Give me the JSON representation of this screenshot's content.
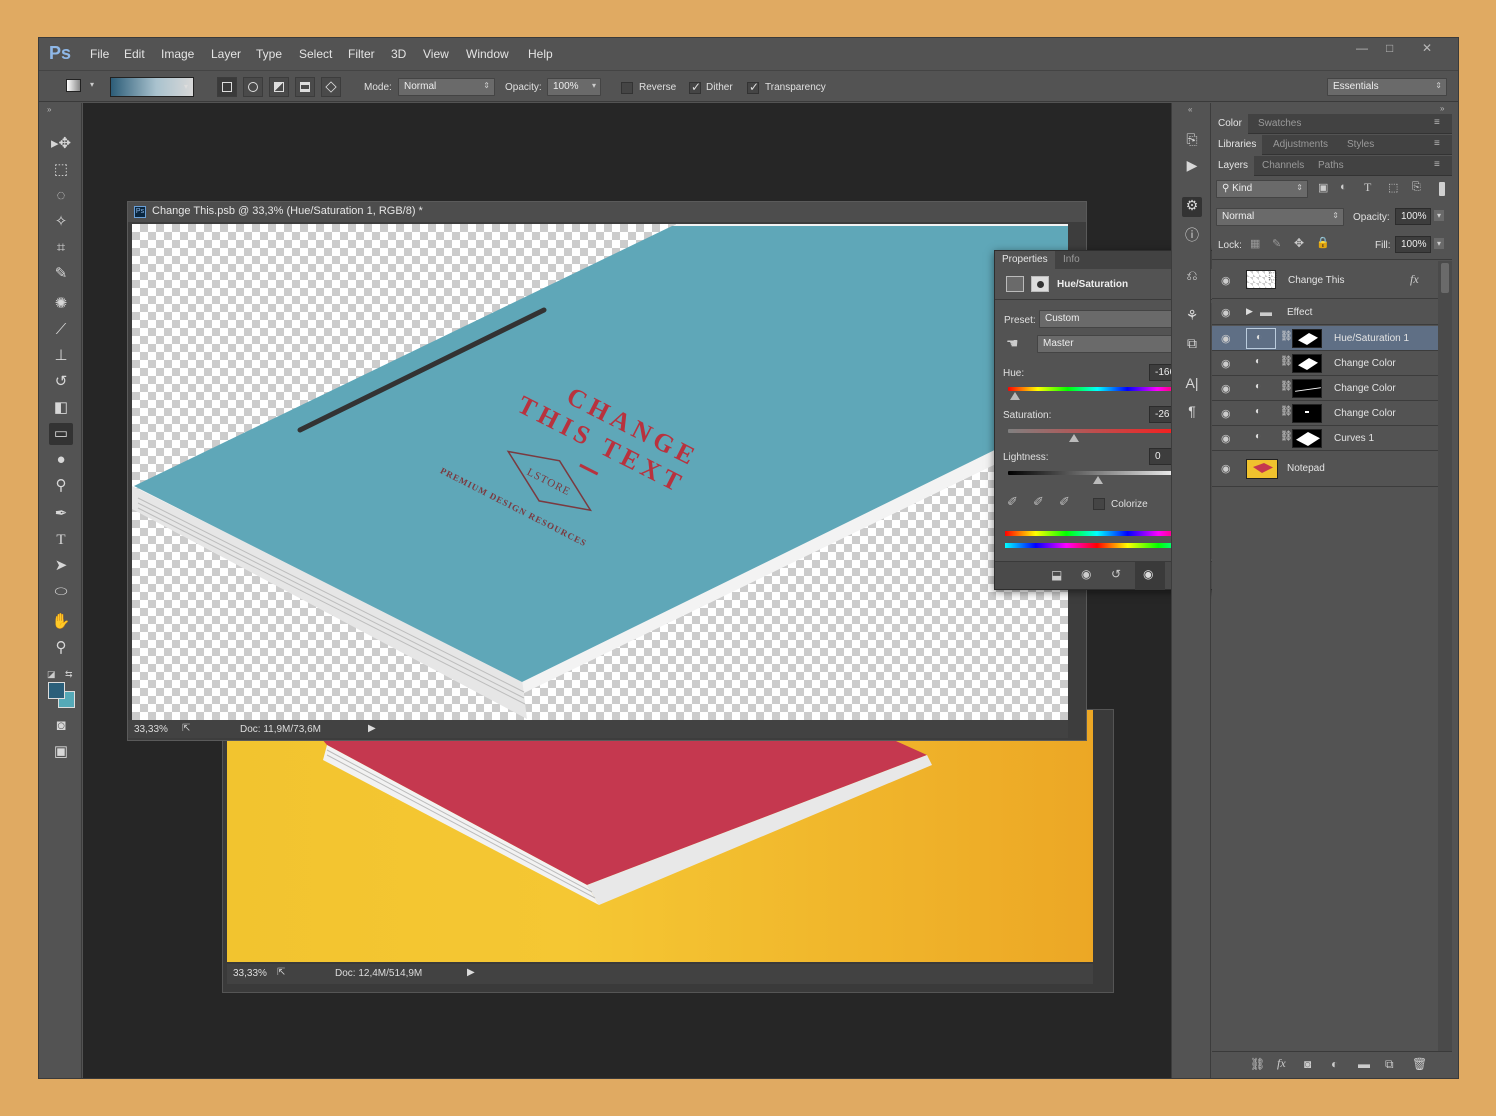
{
  "app": {
    "logo": "Ps"
  },
  "menu": [
    "File",
    "Edit",
    "Image",
    "Layer",
    "Type",
    "Select",
    "Filter",
    "3D",
    "View",
    "Window",
    "Help"
  ],
  "window_controls": {
    "minimize": "—",
    "maximize": "□",
    "close": "✕"
  },
  "options": {
    "mode_label": "Mode:",
    "mode_value": "Normal",
    "opacity_label": "Opacity:",
    "opacity_value": "100%",
    "reverse_label": "Reverse",
    "reverse_checked": false,
    "dither_label": "Dither",
    "dither_checked": true,
    "transparency_label": "Transparency",
    "transparency_checked": true,
    "workspace": "Essentials"
  },
  "doc_front": {
    "title": "Change This.psb @ 33,3% (Hue/Saturation 1, RGB/8) *",
    "zoom": "33,33%",
    "doc_size": "Doc: 11,9M/73,6M",
    "cover_text_line1": "CHANGE",
    "cover_text_line2": "THIS TEXT",
    "cover_brand": "LSTORE",
    "cover_tagline": "PREMIUM DESIGN RESOURCES",
    "cover_color": "#5fa7b8"
  },
  "doc_back": {
    "zoom": "33,33%",
    "doc_size": "Doc: 12,4M/514,9M",
    "cover_color": "#c5384f"
  },
  "properties": {
    "tabs": [
      "Properties",
      "Info"
    ],
    "adjustment": "Hue/Saturation",
    "preset_label": "Preset:",
    "preset_value": "Custom",
    "channel_value": "Master",
    "hue_label": "Hue:",
    "hue_value": "-166",
    "saturation_label": "Saturation:",
    "saturation_value": "-26",
    "lightness_label": "Lightness:",
    "lightness_value": "0",
    "hue_level": -166,
    "saturation_level": -26,
    "lightness_level": 0,
    "colorize_label": "Colorize",
    "colorize_checked": false
  },
  "panels": {
    "row1": [
      "Color",
      "Swatches"
    ],
    "row2": [
      "Libraries",
      "Adjustments",
      "Styles"
    ],
    "row3": [
      "Layers",
      "Channels",
      "Paths"
    ]
  },
  "layers_panel": {
    "filter_kind": "Kind",
    "blend_mode": "Normal",
    "opacity_label": "Opacity:",
    "opacity_value": "100%",
    "lock_label": "Lock:",
    "fill_label": "Fill:",
    "fill_value": "100%",
    "fx_label": "fx",
    "layers": [
      {
        "name": "Change This"
      },
      {
        "name": "Effect"
      },
      {
        "name": "Hue/Saturation 1"
      },
      {
        "name": "Change Color"
      },
      {
        "name": "Change Color"
      },
      {
        "name": "Change Color"
      },
      {
        "name": "Curves 1"
      },
      {
        "name": "Notepad"
      }
    ]
  },
  "colors": {
    "foreground": "#2b5f7a",
    "background": "#55a9b7"
  }
}
